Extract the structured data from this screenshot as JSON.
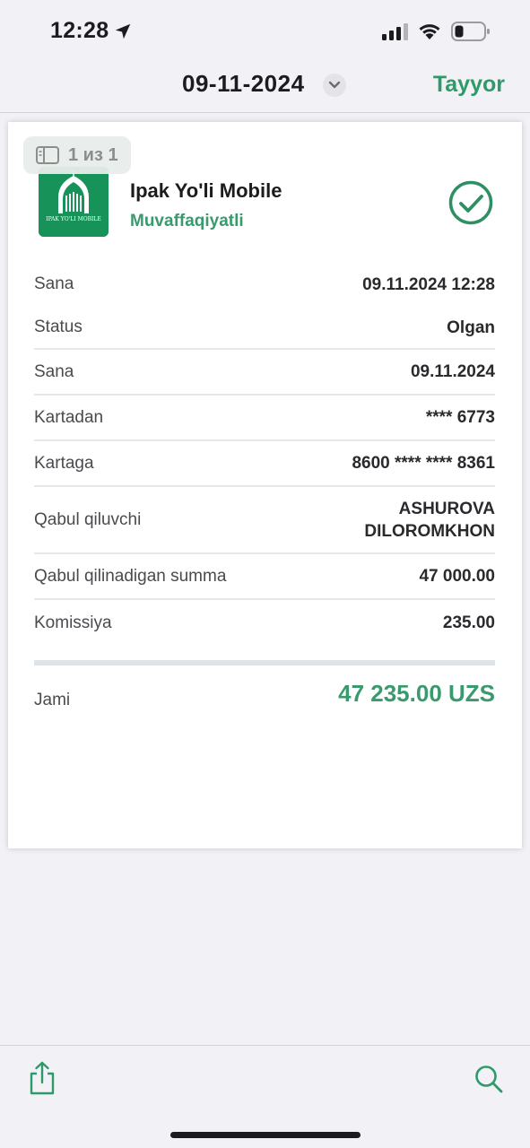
{
  "status_bar": {
    "time": "12:28"
  },
  "nav": {
    "title": "09-11-2024",
    "done_label": "Tayyor"
  },
  "badge": {
    "page_count": "1 из 1"
  },
  "receipt": {
    "app_name": "Ipak Yo'li Mobile",
    "status": "Muvaffaqiyatli",
    "logo_text": "IPAK YO'LI MOBILE",
    "rows": [
      {
        "label": "Sana",
        "value": "09.11.2024 12:28"
      },
      {
        "label": "Status",
        "value": "Olgan"
      },
      {
        "label": "Sana",
        "value": "09.11.2024"
      },
      {
        "label": "Kartadan",
        "value": "**** 6773"
      },
      {
        "label": "Kartaga",
        "value": "8600 **** **** 8361"
      },
      {
        "label": "Qabul qiluvchi",
        "value": "ASHUROVA DILOROMKHON"
      },
      {
        "label": "Qabul qilinadigan summa",
        "value": "47 000.00"
      },
      {
        "label": "Komissiya",
        "value": "235.00"
      }
    ],
    "total_label": "Jami",
    "total_value": "47 235.00 UZS"
  },
  "colors": {
    "accent": "#2e9a6a",
    "background": "#f2f2f6"
  },
  "icons": [
    "location-arrow-icon",
    "signal-icon",
    "wifi-icon",
    "battery-icon",
    "chevron-down-icon",
    "page-icon",
    "check-circle-icon",
    "share-icon",
    "search-icon"
  ]
}
